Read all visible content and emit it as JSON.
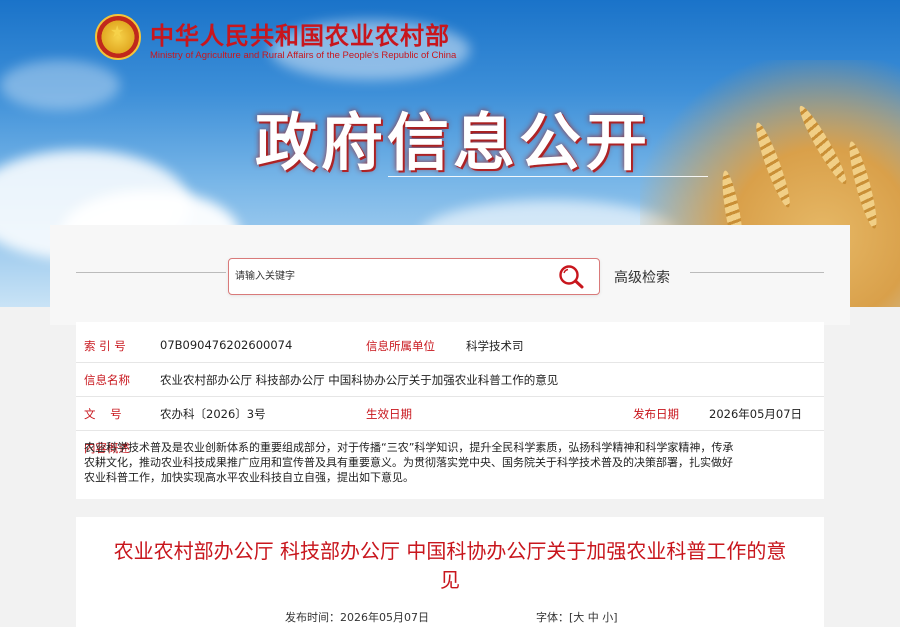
{
  "header": {
    "ministry_cn": "中华人民共和国农业农村部",
    "ministry_en": "Ministry of Agriculture and Rural Affairs of the People's Republic of China",
    "hero_title": "政府信息公开"
  },
  "search": {
    "placeholder": "请输入关键字",
    "advanced_label": "高级检索"
  },
  "info": {
    "index_label": "索 引 号",
    "index_value": "07B090476202600074",
    "unit_label": "信息所属单位",
    "unit_value": "科学技术司",
    "name_label": "信息名称",
    "name_value": "农业农村部办公厅 科技部办公厅 中国科协办公厅关于加强农业科普工作的意见",
    "doc_label": "文    号",
    "doc_value": "农办科〔2026〕3号",
    "effective_label": "生效日期",
    "effective_value": "",
    "publish_label": "发布日期",
    "publish_value": "2026年05月07日",
    "summary_label": "内容概述",
    "summary_value": "农业科学技术普及是农业创新体系的重要组成部分，对于传播“三农”科学知识，提升全民科学素质，弘扬科学精神和科学家精神，传承农耕文化，推动农业科技成果推广应用和宣传普及具有重要意义。为贯彻落实党中央、国务院关于科学技术普及的决策部署，扎实做好农业科普工作，加快实现高水平农业科技自立自强，提出如下意见。"
  },
  "article": {
    "title": "农业农村部办公厅 科技部办公厅 中国科协办公厅关于加强农业科普工作的意见",
    "publish_time_label": "发布时间：2026年05月07日",
    "font_label": "字体：[",
    "font_large": "大",
    "font_medium": "中",
    "font_small": "小",
    "font_close": "]"
  },
  "colors": {
    "accent": "#c8161d",
    "banner_blue": "#3d8fd8"
  },
  "icons": {
    "search": "search-icon",
    "emblem": "national-emblem-icon"
  }
}
